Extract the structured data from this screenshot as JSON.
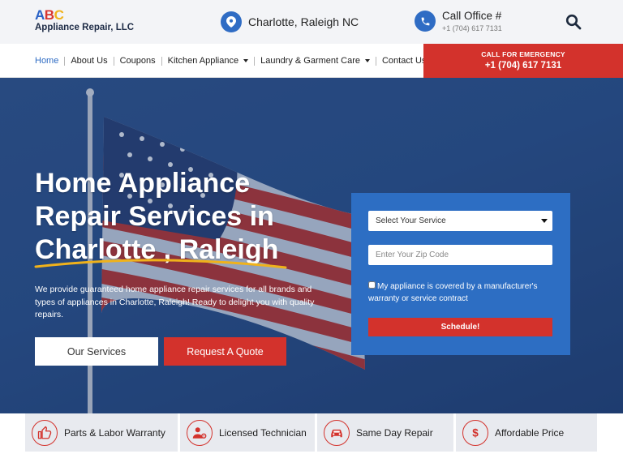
{
  "logo": {
    "abc_a": "A",
    "abc_b": "B",
    "abc_c": "C",
    "company": "Appliance Repair, LLC"
  },
  "header": {
    "location": "Charlotte, Raleigh NC",
    "office_label": "Call Office #",
    "office_phone": "+1 (704) 617 7131"
  },
  "nav": {
    "items": [
      {
        "label": "Home",
        "active": true
      },
      {
        "label": "About Us"
      },
      {
        "label": "Coupons"
      },
      {
        "label": "Kitchen Appliance",
        "dropdown": true
      },
      {
        "label": "Laundry & Garment Care",
        "dropdown": true
      },
      {
        "label": "Contact Us"
      }
    ]
  },
  "emergency": {
    "label": "CALL FOR EMERGENCY",
    "phone": "+1 (704) 617 7131"
  },
  "hero": {
    "line1": "Home Appliance",
    "line2": "Repair Services in",
    "line3": "Charlotte , Raleigh",
    "description": "We provide guaranteed home appliance repair services for all brands and types of appliances in Charlotte, Raleigh! Ready to delight you with quality repairs.",
    "btn_services": "Our Services",
    "btn_quote": "Request A Quote"
  },
  "form": {
    "select_value": "Select Your Service",
    "zip_placeholder": "Enter Your Zip Code",
    "checkbox_label": "My appliance is covered by a manufacturer's warranty or service contract",
    "schedule_label": "Schedule!"
  },
  "features": [
    {
      "label": "Parts & Labor Warranty",
      "icon": "thumbs-up-icon"
    },
    {
      "label": "Licensed Technician",
      "icon": "technician-icon"
    },
    {
      "label": "Same Day Repair",
      "icon": "car-icon"
    },
    {
      "label": "Affordable Price",
      "icon": "dollar-icon"
    }
  ],
  "colors": {
    "brand_blue": "#2f6cc4",
    "brand_red": "#d3322c",
    "accent_yellow": "#f0b21b"
  }
}
